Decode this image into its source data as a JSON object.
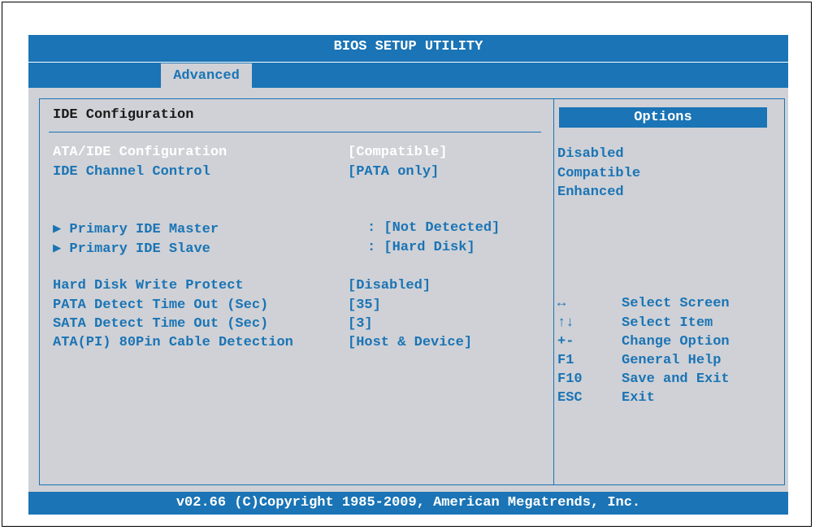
{
  "title": "BIOS SETUP UTILITY",
  "tabs": [
    {
      "label": "Advanced"
    }
  ],
  "section": {
    "title": "IDE Configuration"
  },
  "settings": [
    {
      "label": "ATA/IDE Configuration",
      "value": "[Compatible]"
    },
    {
      "label": "IDE Channel Control",
      "value": "[PATA only]"
    },
    {
      "label": "▶ Primary IDE Master",
      "value": ": [Not Detected]"
    },
    {
      "label": "▶ Primary IDE Slave",
      "value": ": [Hard Disk]"
    },
    {
      "label": "Hard Disk Write Protect",
      "value": "[Disabled]"
    },
    {
      "label": "PATA Detect Time Out (Sec)",
      "value": "[35]"
    },
    {
      "label": "SATA Detect Time Out (Sec)",
      "value": "[3]"
    },
    {
      "label": "ATA(PI) 80Pin Cable Detection",
      "value": "[Host & Device]"
    }
  ],
  "options": {
    "header": "Options",
    "items": [
      "Disabled",
      "Compatible",
      "Enhanced"
    ]
  },
  "help": [
    {
      "key": "↔",
      "desc": "Select Screen",
      "icon": "left-right-arrow-icon"
    },
    {
      "key": "↑↓",
      "desc": "Select Item",
      "icon": "up-down-arrow-icon"
    },
    {
      "key": "+-",
      "desc": "Change Option"
    },
    {
      "key": "F1",
      "desc": "General Help"
    },
    {
      "key": "F10",
      "desc": "Save and Exit"
    },
    {
      "key": "ESC",
      "desc": "Exit"
    }
  ],
  "footer": "v02.66 (C)Copyright 1985-2009, American Megatrends, Inc.",
  "colors": {
    "accent": "#1a74b5",
    "panel": "#cfd1d6",
    "highlight_text": "#ffffff"
  }
}
